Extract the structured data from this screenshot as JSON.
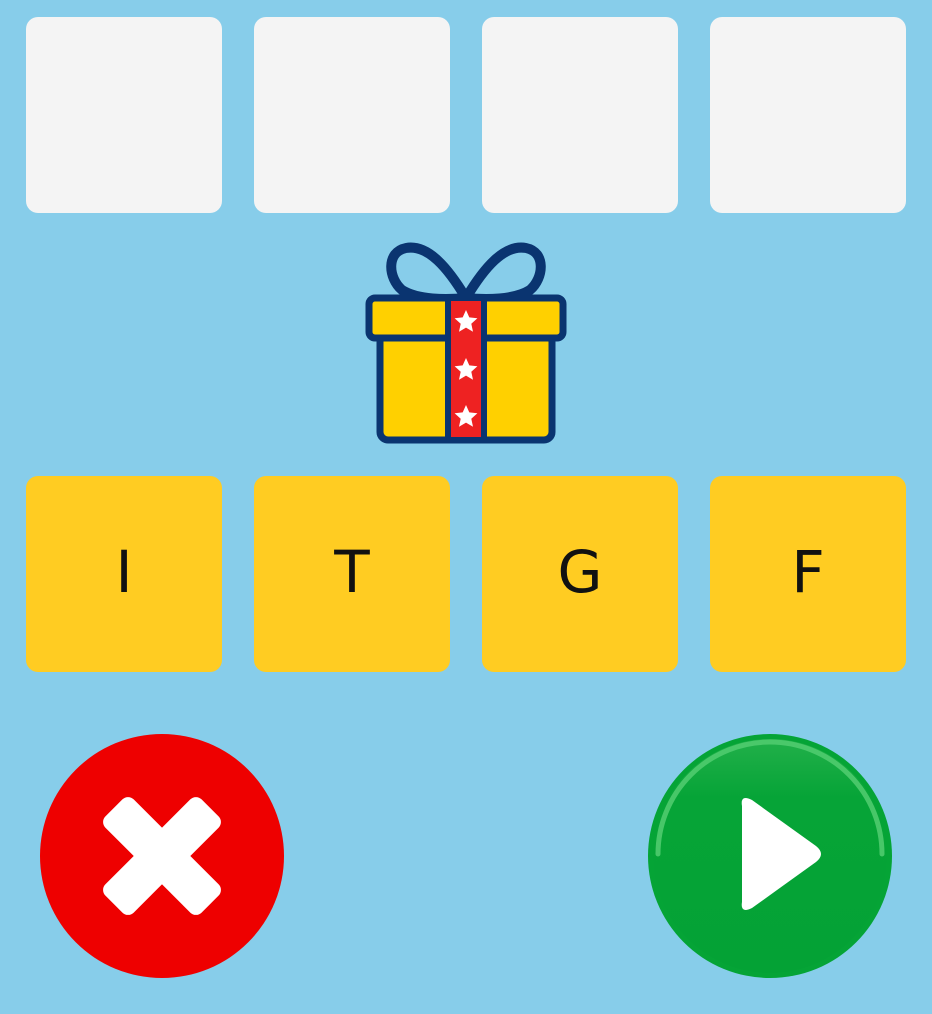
{
  "answer_slots": [
    {
      "letter": ""
    },
    {
      "letter": ""
    },
    {
      "letter": ""
    },
    {
      "letter": ""
    }
  ],
  "clue": {
    "icon": "gift-icon"
  },
  "letter_tiles": [
    {
      "letter": "I"
    },
    {
      "letter": "T"
    },
    {
      "letter": "G"
    },
    {
      "letter": "F"
    }
  ],
  "controls": {
    "clear_icon": "x-icon",
    "submit_icon": "play-icon"
  },
  "colors": {
    "background": "#87CDEA",
    "slot": "#F4F4F4",
    "tile": "#FFCC22",
    "clear_button": "#EE0000",
    "submit_button": "#05A436",
    "gift_box": "#FFD000",
    "gift_ribbon": "#EE2222",
    "gift_outline": "#0A3470"
  }
}
